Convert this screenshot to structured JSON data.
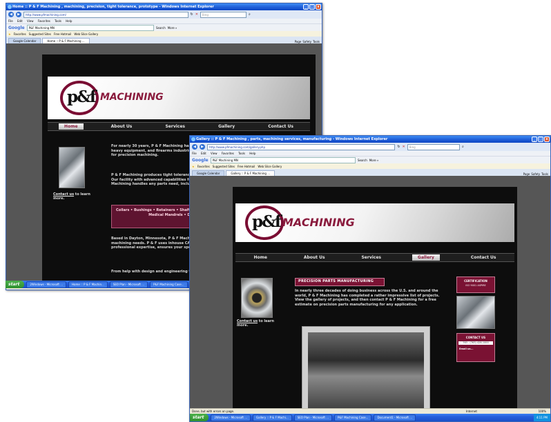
{
  "window1": {
    "title": "Home :: P & F Machining , machining, precision, tight tolerance, prototype - Windows Internet Explorer",
    "address": "http://www.pfmachining.com/",
    "search_placeholder": "Bing",
    "menu": [
      "File",
      "Edit",
      "View",
      "Favorites",
      "Tools",
      "Help"
    ],
    "google_search": "P&F Machining MN",
    "google_buttons": [
      "Search",
      "More »"
    ],
    "favorites_label": "Favorites",
    "fav_items": [
      "Suggested Sites",
      "Free Hotmail",
      "Web Slice Gallery"
    ],
    "tabs": [
      "Google Calendar",
      "Home :: P & F Machining ..."
    ],
    "command_items": [
      "Page",
      "Safety",
      "Tools"
    ],
    "nav": [
      "Home",
      "About Us",
      "Services",
      "Gallery",
      "Contact Us"
    ],
    "nav_selected": "Home",
    "logo_text": "MACHINING",
    "logo_initials": "p&f",
    "sidebar_link": "Contact us",
    "sidebar_suffix": " to learn more.",
    "intro": "For nearly 30 years, P & F Machining has provided high-quality custom machining for the agricultural, heavy equipment, and firearms industries throughout the U.S., and an ever-widening reliable source for precision machining.",
    "para2": "P & F Machining produces tight tolerance parts to your expectations, along with competitive pricing. Our facility with advanced capabilities for precision manufacturing, and efficient service. P & F Machining handles any parts need, including the following.",
    "callout": "Collars • Bushings • Retainers • Shafts • Precision Motor Shafts • Medical Mandrels • Dairy Fitting",
    "para3": "Based in Dayton, Minnesota, P & F Machining uses its facility with advanced capabilities to meet your machining needs. P & F uses inhouse CAD/CAM software as their primary operating, along with their professional expertise, ensures your specifications. P & F Machining won't.",
    "para4": "From help with design and engineering to delivery, P & F Machining is your",
    "status": "Done",
    "start_label": "start",
    "taskbar_items": [
      "2Windows - Microsoft ...",
      "Home :: P & F Machin...",
      "SEO Plan - Microsoft ...",
      "P&F Machining Case..."
    ]
  },
  "window2": {
    "title": "Gallery :: P & F Machining , parts, machining services, manufacturing - Windows Internet Explorer",
    "address": "http://www.pfmachining.com/gallery.php",
    "search_placeholder": "Bing",
    "menu": [
      "File",
      "Edit",
      "View",
      "Favorites",
      "Tools",
      "Help"
    ],
    "google_search": "P&F Machining MN",
    "google_buttons": [
      "Search",
      "More »"
    ],
    "favorites_label": "Favorites",
    "fav_items": [
      "Suggested Sites",
      "Free Hotmail",
      "Web Slice Gallery"
    ],
    "tabs": [
      "Google Calendar",
      "Gallery :: P & F Machining ..."
    ],
    "command_items": [
      "Page",
      "Safety",
      "Tools"
    ],
    "nav": [
      "Home",
      "About Us",
      "Services",
      "Gallery",
      "Contact Us"
    ],
    "nav_selected": "Gallery",
    "logo_text": "MACHINING",
    "logo_initials": "p&f",
    "sidebar_link": "Contact us",
    "sidebar_suffix": " to learn more.",
    "section_heading": "PRECISION PARTS MANUFACTURING",
    "gallery_text": "In nearly three decades of doing business across the U.S. and around the world, P & F Machining has completed a rather impressive list of projects. View the gallery of projects, and then contact P & F Machining for a free estimate on precision parts manufacturing for any application.",
    "certification_label": "CERTIFICATION",
    "certification_sub": "ISO 9001 ASPIRE",
    "contact_label": "CONTACT US",
    "contact_phone": "763 - (763) 428-1000",
    "contact_email": "Email us...",
    "status": "Done, but with errors on page.",
    "status_zone": "Internet",
    "zoom": "100%",
    "start_label": "start",
    "taskbar_items": [
      "2Windows - Microsoft ...",
      "Gallery :: P & F Machi...",
      "SEO Plan - Microsoft ...",
      "P&F Machining Case...",
      "Document1 - Microsoft ..."
    ],
    "clock": "4:11 PM"
  }
}
